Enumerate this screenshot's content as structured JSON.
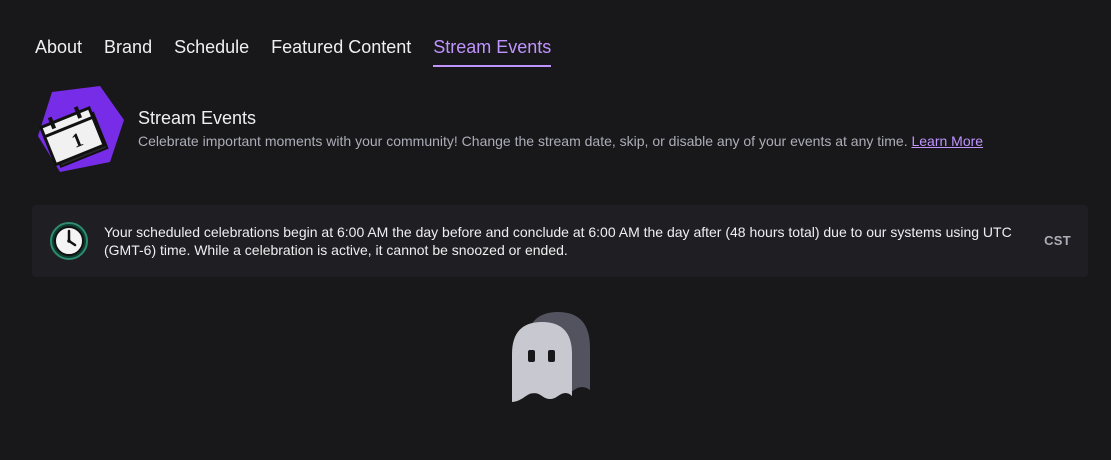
{
  "tabs": [
    {
      "label": "About",
      "active": false
    },
    {
      "label": "Brand",
      "active": false
    },
    {
      "label": "Schedule",
      "active": false
    },
    {
      "label": "Featured Content",
      "active": false
    },
    {
      "label": "Stream Events",
      "active": true
    }
  ],
  "hero": {
    "title": "Stream Events",
    "description": "Celebrate important moments with your community! Change the stream date, skip, or disable any of your events at any time.",
    "link_label": "Learn More",
    "icon": "calendar-icon"
  },
  "notice": {
    "icon": "clock-icon",
    "text": "Your scheduled celebrations begin at 6:00 AM the day before and conclude at 6:00 AM the day after (48 hours total) due to our systems using UTC (GMT-6) time. While a celebration is active, it cannot be snoozed or ended.",
    "timezone": "CST"
  },
  "empty_state": {
    "icon": "ghost-icon"
  },
  "colors": {
    "accent": "#bf94ff",
    "background": "#18181b",
    "panel": "#1f1f23",
    "hero_purple": "#772ce8"
  }
}
